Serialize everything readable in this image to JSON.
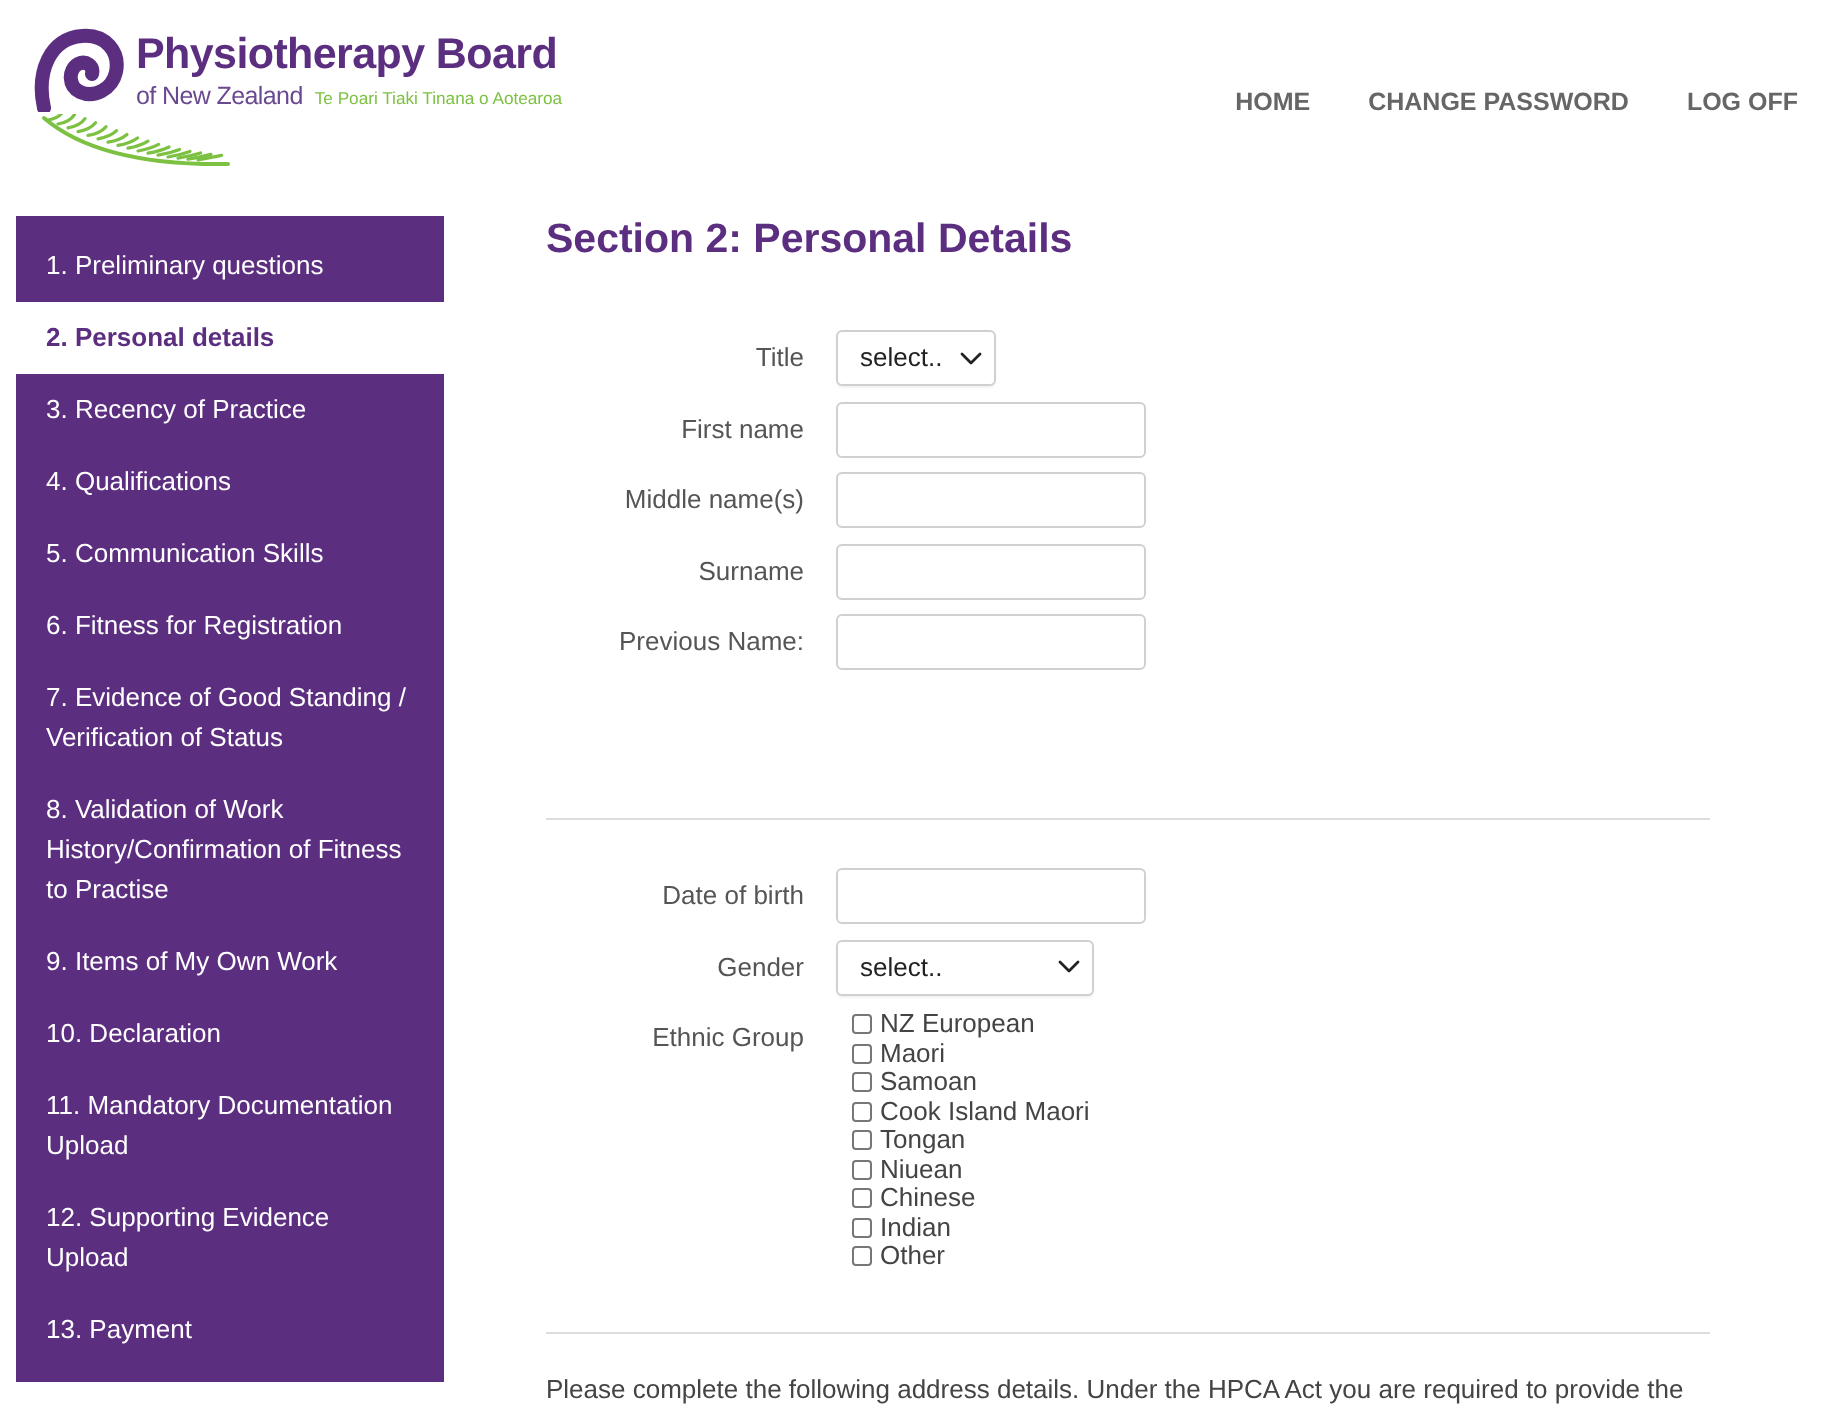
{
  "header": {
    "logo": {
      "name": "Physiotherapy Board",
      "subtitle": "of New Zealand",
      "tagline": "Te Poari Tiaki Tinana o Aotearoa"
    },
    "nav": [
      "HOME",
      "CHANGE PASSWORD",
      "LOG OFF"
    ]
  },
  "sidebar": {
    "items": [
      {
        "label": "1. Preliminary questions",
        "selected": false
      },
      {
        "label": "2. Personal details",
        "selected": true
      },
      {
        "label": "3. Recency of Practice",
        "selected": false
      },
      {
        "label": "4. Qualifications",
        "selected": false
      },
      {
        "label": "5. Communication Skills",
        "selected": false
      },
      {
        "label": "6. Fitness for Registration",
        "selected": false
      },
      {
        "label": "7. Evidence of Good Standing / Verification of Status",
        "selected": false
      },
      {
        "label": "8. Validation of Work History/Confirmation of Fitness to Practise",
        "selected": false
      },
      {
        "label": "9. Items of My Own Work",
        "selected": false
      },
      {
        "label": "10. Declaration",
        "selected": false
      },
      {
        "label": "11. Mandatory Documentation Upload",
        "selected": false
      },
      {
        "label": "12. Supporting Evidence Upload",
        "selected": false
      },
      {
        "label": "13. Payment",
        "selected": false
      }
    ]
  },
  "main": {
    "heading": "Section 2: Personal Details",
    "name_fields": [
      {
        "label": "Title",
        "kind": "select",
        "value": "select.."
      },
      {
        "label": "First name",
        "kind": "text"
      },
      {
        "label": "Middle name(s)",
        "kind": "text"
      },
      {
        "label": "Surname",
        "kind": "text"
      },
      {
        "label": "Previous Name:",
        "kind": "text"
      }
    ],
    "personal_fields": [
      {
        "label": "Date of birth",
        "kind": "text"
      },
      {
        "label": "Gender",
        "kind": "select",
        "value": "select.."
      }
    ],
    "ethnic_group": {
      "label": "Ethnic Group",
      "options": [
        {
          "label": "NZ European",
          "checked": false
        },
        {
          "label": "Maori",
          "checked": false
        },
        {
          "label": "Samoan",
          "checked": false
        },
        {
          "label": "Cook Island Maori",
          "checked": false
        },
        {
          "label": "Tongan",
          "checked": false
        },
        {
          "label": "Niuean",
          "checked": false
        },
        {
          "label": "Chinese",
          "checked": false
        },
        {
          "label": "Indian",
          "checked": false
        },
        {
          "label": "Other",
          "checked": false
        }
      ]
    },
    "address_note": "Please complete the following address details. Under the HPCA Act you are required to provide the"
  }
}
